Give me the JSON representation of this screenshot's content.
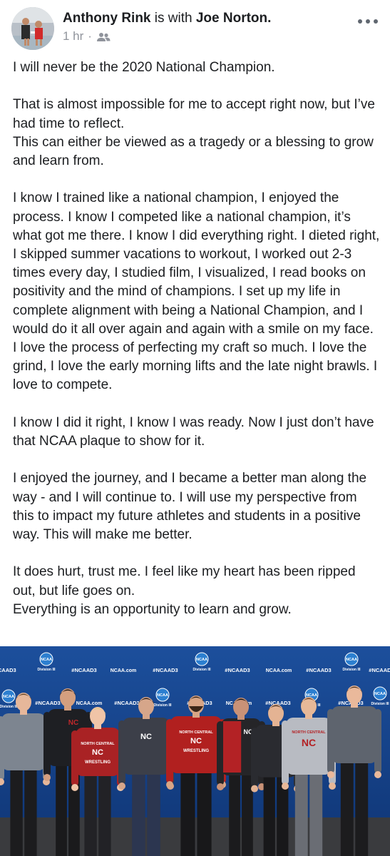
{
  "post": {
    "author": "Anthony Rink",
    "with_text": "is with",
    "tagged": "Joe Norton.",
    "time": "1 hr",
    "separator": "·",
    "audience_icon": "friends-icon",
    "more_icon": "more-dots-icon"
  },
  "paragraphs": [
    [
      "I will never be the 2020 National Champion."
    ],
    [
      "That is almost impossible for me to accept right now, but I’ve had time to reflect.",
      "This can either be viewed as a tragedy or a blessing to grow and learn from."
    ],
    [
      "I know I trained like a national champion, I enjoyed the process. I know I competed like a national champion, it’s what got me there. I know I did everything right. I dieted right, I skipped summer vacations to workout, I worked out 2-3 times every day, I studied film, I visualized, I read books on positivity and the mind of champions. I set up my life in complete alignment with being a National Champion, and I would do it all over again and again with a smile on my face.",
      "I love the process of perfecting my craft so much. I love the grind, I love the early morning lifts and the late night brawls. I love to compete."
    ],
    [
      "I know I did it right, I know I was ready. Now I just don’t have that NCAA plaque to show for it."
    ],
    [
      "I enjoyed the journey, and I became a better man along the way - and I will continue to. I will use my perspective from this to impact my future athletes and students in a positive way. This will make me better."
    ],
    [
      "It does hurt, trust me. I feel like my heart has been ripped out, but life goes on.",
      "Everything is an opportunity to learn and grow."
    ]
  ],
  "photo": {
    "backdrop_text": {
      "hashtag": "#NCAAD3",
      "ncaa": "NCAA",
      "division": "Division III",
      "site": "NCAA.com"
    },
    "shirt_text": {
      "north_central": "NORTH CENTRAL",
      "wrestling": "WRESTLING",
      "monogram": "NC"
    }
  }
}
